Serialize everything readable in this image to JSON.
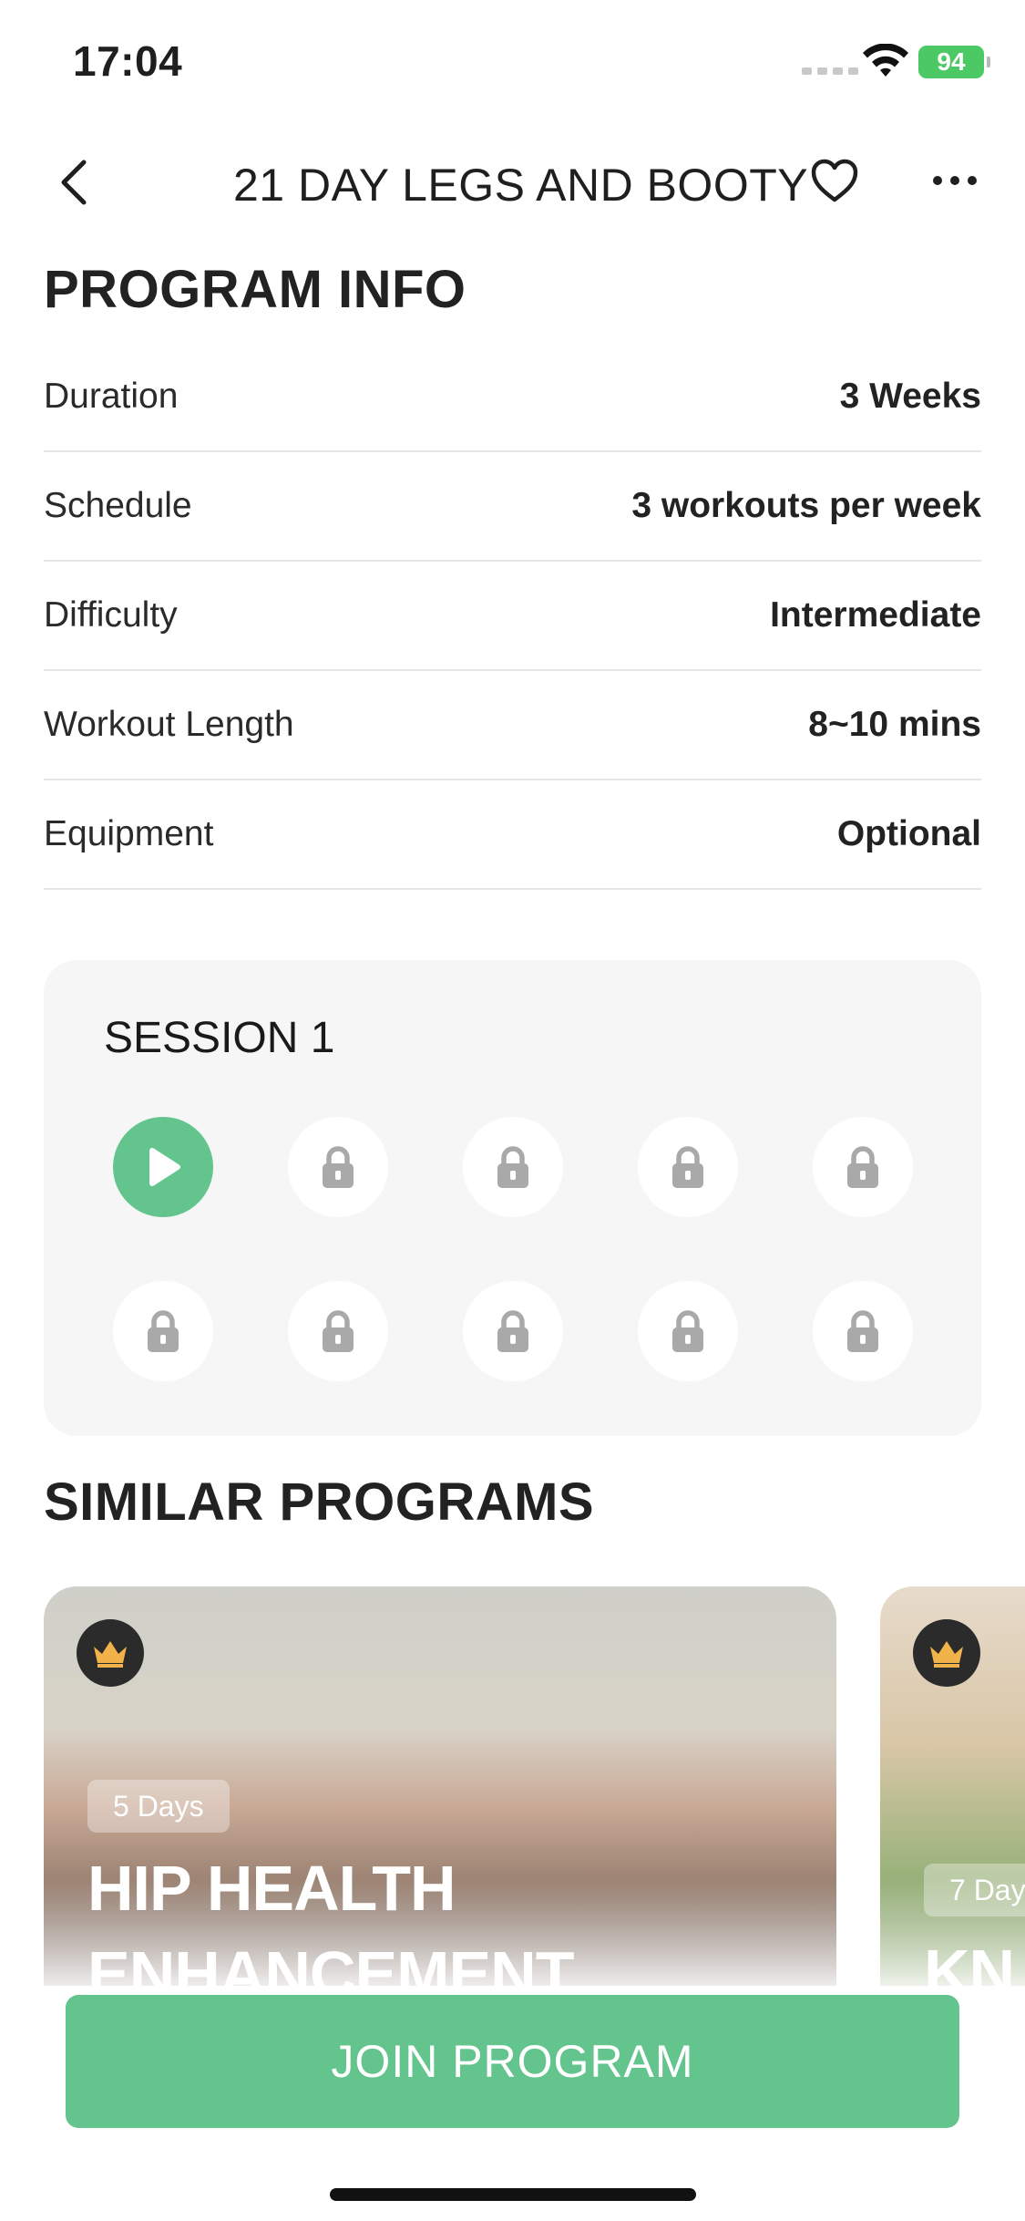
{
  "status_bar": {
    "time": "17:04",
    "battery": "94"
  },
  "header": {
    "title": "21 DAY LEGS AND BOOTY"
  },
  "program_info": {
    "heading": "PROGRAM INFO",
    "rows": [
      {
        "label": "Duration",
        "value": "3 Weeks"
      },
      {
        "label": "Schedule",
        "value": "3 workouts per week"
      },
      {
        "label": "Difficulty",
        "value": "Intermediate"
      },
      {
        "label": "Workout Length",
        "value": "8~10 mins"
      },
      {
        "label": "Equipment",
        "value": "Optional"
      }
    ]
  },
  "session": {
    "title": "SESSION 1",
    "workouts": [
      {
        "state": "play"
      },
      {
        "state": "locked"
      },
      {
        "state": "locked"
      },
      {
        "state": "locked"
      },
      {
        "state": "locked"
      },
      {
        "state": "locked"
      },
      {
        "state": "locked"
      },
      {
        "state": "locked"
      },
      {
        "state": "locked"
      },
      {
        "state": "locked"
      }
    ]
  },
  "similar_programs": {
    "heading": "SIMILAR PROGRAMS",
    "cards": [
      {
        "days": "5 Days",
        "title": "HIP HEALTH ENHANCEMENT",
        "premium_icon": "crown-icon"
      },
      {
        "days": "7 Day",
        "title": "KN",
        "premium_icon": "crown-icon"
      }
    ]
  },
  "join_button": {
    "label": "JOIN PROGRAM"
  },
  "colors": {
    "accent": "#63c48d",
    "battery": "#4cc864",
    "card_bg": "#f6f6f6"
  }
}
